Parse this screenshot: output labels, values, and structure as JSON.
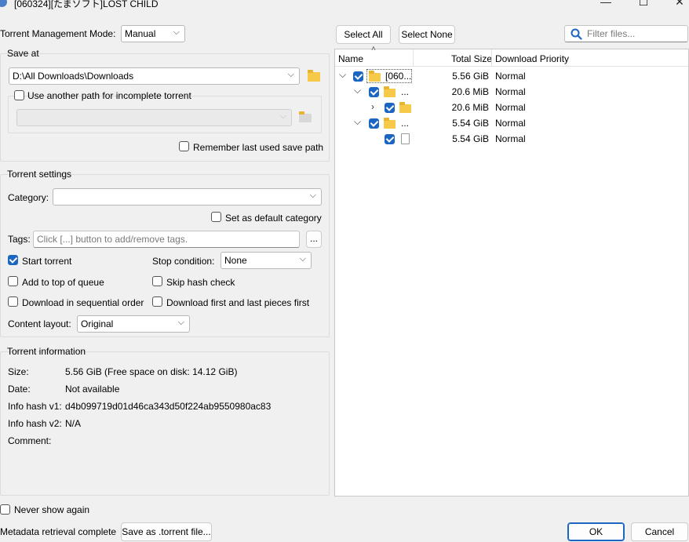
{
  "window": {
    "title": "[060324][たまソフト]LOST CHILD",
    "minimize": "—",
    "maximize": "☐",
    "close": "✕"
  },
  "mode": {
    "label": "Torrent Management Mode:",
    "value": "Manual"
  },
  "save_at": {
    "title": "Save at",
    "path": "D:\\All Downloads\\Downloads",
    "incomplete_label": "Use another path for incomplete torrent",
    "incomplete_checked": false,
    "remember_label": "Remember last used save path",
    "remember_checked": false
  },
  "torrent_settings": {
    "title": "Torrent settings",
    "category_label": "Category:",
    "category_value": "",
    "default_category_label": "Set as default category",
    "tags_label": "Tags:",
    "tags_placeholder": "Click [...] button to add/remove tags.",
    "tags_button": "...",
    "start_torrent": {
      "label": "Start torrent",
      "checked": true
    },
    "stop_condition": {
      "label": "Stop condition:",
      "value": "None"
    },
    "add_top_queue": {
      "label": "Add to top of queue",
      "checked": false
    },
    "skip_hash": {
      "label": "Skip hash check",
      "checked": false
    },
    "sequential": {
      "label": "Download in sequential order",
      "checked": false
    },
    "first_last": {
      "label": "Download first and last pieces first",
      "checked": false
    },
    "content_layout": {
      "label": "Content layout:",
      "value": "Original"
    }
  },
  "torrent_info": {
    "title": "Torrent information",
    "size_label": "Size:",
    "size_value": "5.56 GiB (Free space on disk: 14.12 GiB)",
    "date_label": "Date:",
    "date_value": "Not available",
    "hash1_label": "Info hash v1:",
    "hash1_value": "d4b099719d01d46ca343d50f224ab9550980ac83",
    "hash2_label": "Info hash v2:",
    "hash2_value": "N/A",
    "comment_label": "Comment:",
    "comment_value": ""
  },
  "files": {
    "select_all": "Select All",
    "select_none": "Select None",
    "filter_placeholder": "Filter files...",
    "columns": {
      "name": "Name",
      "size": "Total Size",
      "priority": "Download Priority"
    },
    "rows": [
      {
        "name": "[060...",
        "size": "5.56 GiB",
        "priority": "Normal"
      },
      {
        "name": "...",
        "size": "20.6 MiB",
        "priority": "Normal"
      },
      {
        "name": "",
        "size": "20.6 MiB",
        "priority": "Normal"
      },
      {
        "name": "...",
        "size": "5.54 GiB",
        "priority": "Normal"
      },
      {
        "name": "",
        "size": "5.54 GiB",
        "priority": "Normal"
      }
    ]
  },
  "footer": {
    "never_show": "Never show again",
    "metadata_status": "Metadata retrieval complete",
    "save_torrent": "Save as .torrent file...",
    "ok": "OK",
    "cancel": "Cancel"
  },
  "icons": {
    "app": "qbittorrent-icon",
    "folder": "folder-icon",
    "search": "search-icon",
    "file": "file-icon",
    "chevron_down": "chevron-down-icon",
    "chevron_right": "chevron-right-icon"
  },
  "colors": {
    "accent": "#1c66c2",
    "folder": "#f7c948"
  }
}
